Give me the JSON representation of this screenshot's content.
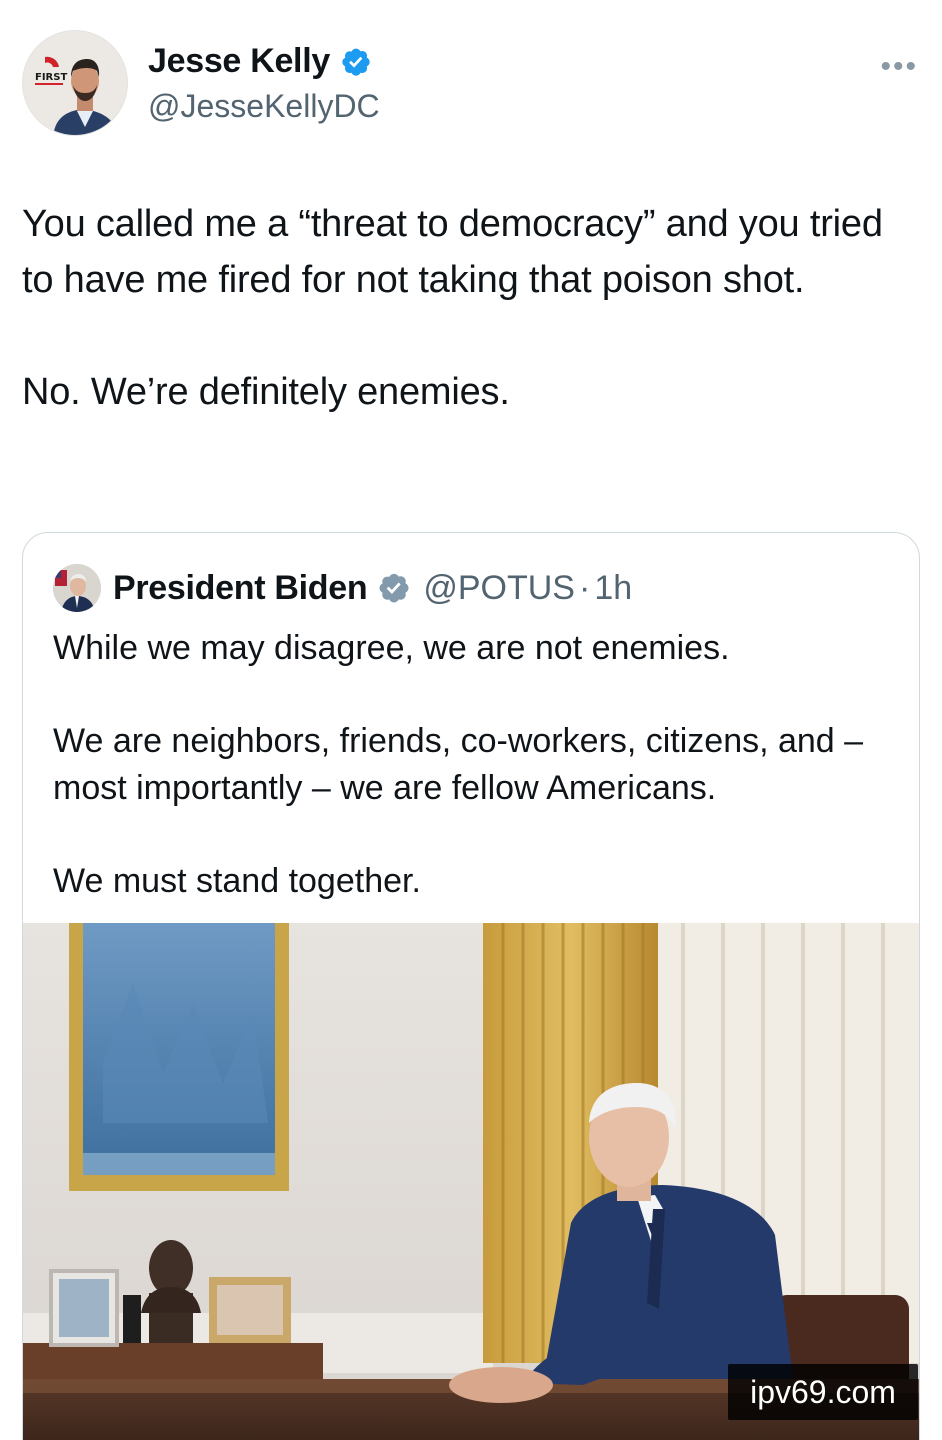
{
  "tweet": {
    "author": {
      "name": "Jesse Kelly",
      "handle": "@JesseKellyDC",
      "verified": true,
      "avatar_badge_text": "THE FIRST"
    },
    "more_icon": "more-horizontal-icon",
    "text": "You called me a “threat to democracy” and you tried to have me fired for not taking that poison shot.\n\nNo. We’re definitely enemies."
  },
  "quoted_tweet": {
    "author": {
      "name": "President Biden",
      "handle": "@POTUS",
      "verified": true,
      "badge": "gray-verified-badge-icon"
    },
    "separator": "·",
    "time": "1h",
    "text": "While we may disagree, we are not enemies.\n\nWe are neighbors, friends, co-workers, citizens, and – most importantly – we are fellow Americans.\n\nWe must stand together.",
    "media": "oval-office-photo"
  },
  "watermark": {
    "text": "ipv69.com"
  },
  "colors": {
    "verified_blue": "#1d9bf0",
    "gray_badge": "#829aab",
    "secondary_text": "#536471",
    "border": "#cfd9de"
  }
}
